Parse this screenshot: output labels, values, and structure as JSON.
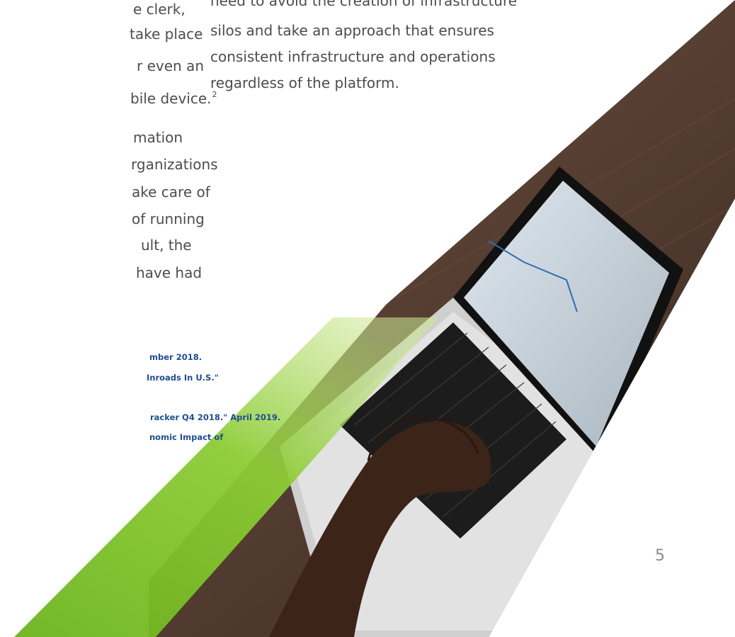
{
  "left_column": {
    "lines": [
      "e clerk,",
      "take place",
      "r even an",
      "bile device.",
      "mation",
      "rganizations",
      "ake care of",
      "of running",
      "ult, the",
      "have had"
    ],
    "superscript": "2"
  },
  "right_column": {
    "lines": [
      "need to avoid the creation of infrastructure",
      "silos and take an approach that ensures",
      "consistent infrastructure and operations",
      "regardless of the platform."
    ]
  },
  "footnotes": [
    "mber 2018.",
    "Inroads In U.S.\"",
    "racker Q4 2018.\" April 2019.",
    "nomic Impact of"
  ],
  "page_number": "5",
  "colors": {
    "accent_green": "#78be20",
    "footnote_blue": "#1d4f91",
    "body_text": "#4d4d4d"
  }
}
